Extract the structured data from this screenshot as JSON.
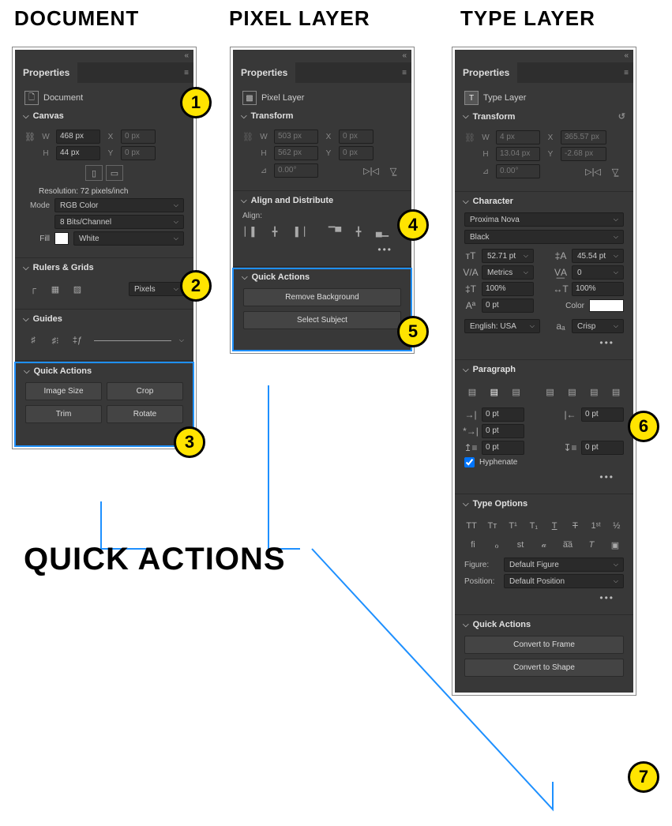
{
  "headers": {
    "doc": "DOCUMENT",
    "pixel": "PIXEL LAYER",
    "type": "TYPE LAYER"
  },
  "quicklabel": "QUICK ACTIONS",
  "doc": {
    "panelTitle": "Properties",
    "layerType": "Document",
    "canvas": {
      "title": "Canvas",
      "w": "468 px",
      "x": "0 px",
      "h": "44 px",
      "y": "0 px",
      "resolution": "Resolution: 72 pixels/inch",
      "modeLabel": "Mode",
      "mode": "RGB Color",
      "bits": "8 Bits/Channel",
      "fillLabel": "Fill",
      "fill": "White"
    },
    "rulers": {
      "title": "Rulers & Grids",
      "unit": "Pixels"
    },
    "guides": {
      "title": "Guides"
    },
    "qa": {
      "title": "Quick Actions",
      "b1": "Image Size",
      "b2": "Crop",
      "b3": "Trim",
      "b4": "Rotate"
    }
  },
  "pixel": {
    "panelTitle": "Properties",
    "layerType": "Pixel Layer",
    "transform": {
      "title": "Transform",
      "w": "503 px",
      "x": "0 px",
      "h": "562 px",
      "y": "0 px",
      "angle": "0.00°"
    },
    "align": {
      "title": "Align and Distribute",
      "label": "Align:"
    },
    "qa": {
      "title": "Quick Actions",
      "b1": "Remove Background",
      "b2": "Select Subject"
    }
  },
  "type": {
    "panelTitle": "Properties",
    "layerType": "Type Layer",
    "transform": {
      "title": "Transform",
      "w": "4 px",
      "x": "365.57 px",
      "h": "13.04 px",
      "y": "-2.68 px",
      "angle": "0.00°"
    },
    "char": {
      "title": "Character",
      "font": "Proxima Nova",
      "weight": "Black",
      "size": "52.71 pt",
      "line": "45.54 pt",
      "kerning": "Metrics",
      "track": "0",
      "vscale": "100%",
      "hscale": "100%",
      "baseline": "0 pt",
      "colorLabel": "Color",
      "lang": "English: USA",
      "aa": "Crisp"
    },
    "para": {
      "title": "Paragraph",
      "il": "0 pt",
      "ir": "0 pt",
      "fl": "0 pt",
      "sb": "0 pt",
      "sa": "0 pt",
      "hyph": "Hyphenate"
    },
    "to": {
      "title": "Type Options",
      "figLabel": "Figure:",
      "fig": "Default Figure",
      "posLabel": "Position:",
      "pos": "Default Position"
    },
    "qa": {
      "title": "Quick Actions",
      "b1": "Convert to Frame",
      "b2": "Convert to Shape"
    }
  }
}
